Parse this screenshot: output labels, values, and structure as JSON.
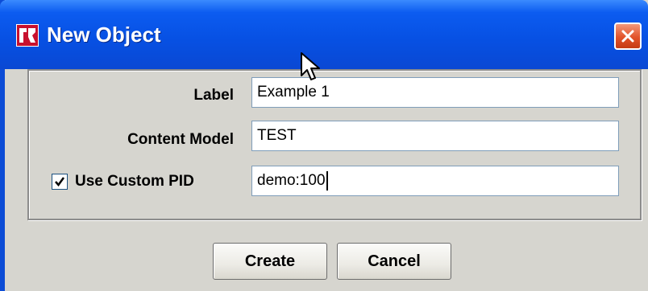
{
  "window": {
    "title": "New Object",
    "icon": "app-logo-icon",
    "close_icon": "close-icon"
  },
  "form": {
    "label": {
      "label": "Label",
      "value": "Example 1"
    },
    "content_model": {
      "label": "Content Model",
      "value": "TEST"
    },
    "custom_pid": {
      "label": "Use Custom PID",
      "checked": true,
      "value": "demo:100"
    }
  },
  "buttons": {
    "create": "Create",
    "cancel": "Cancel"
  },
  "colors": {
    "titlebar": "#0751e4",
    "window_bg": "#d6d5cf",
    "close_button": "#e2532a",
    "field_border": "#7f9db9"
  }
}
